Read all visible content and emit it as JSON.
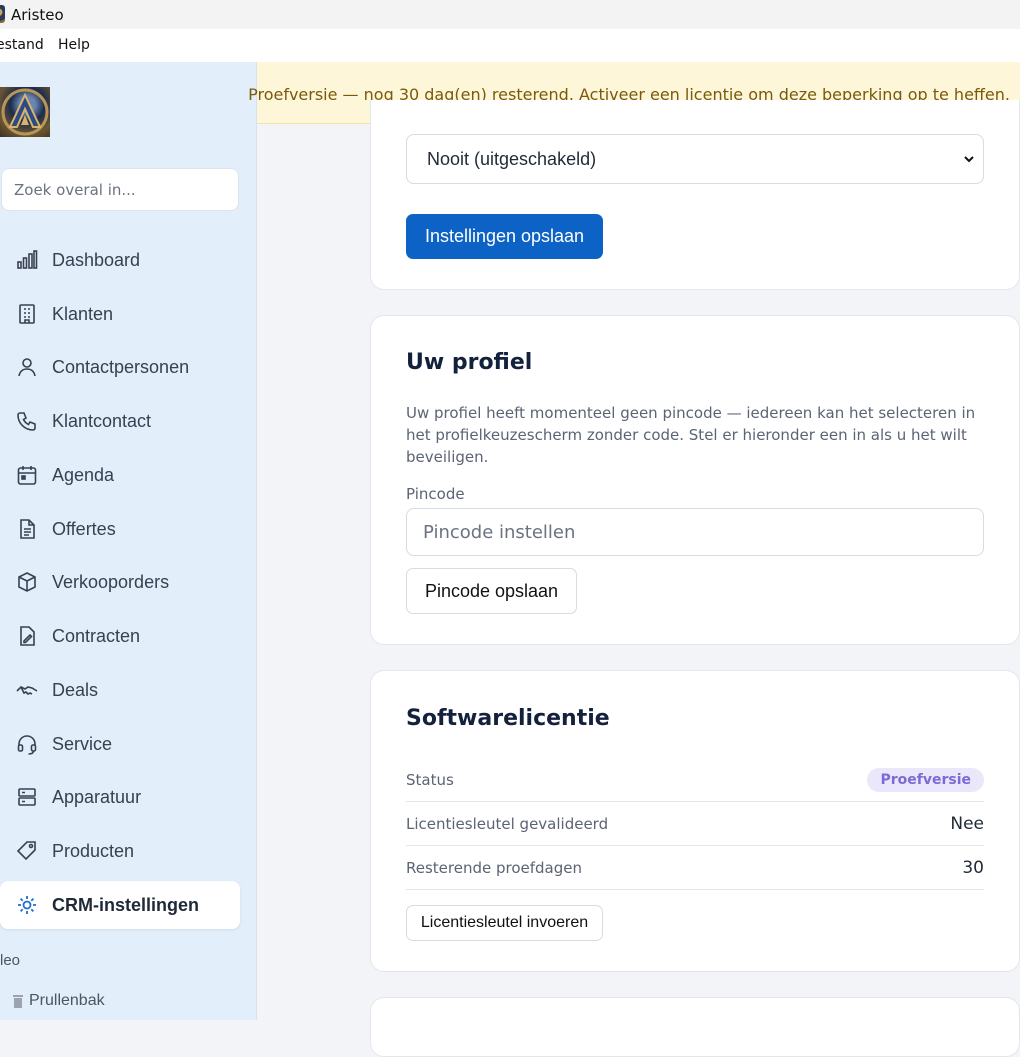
{
  "window": {
    "title": "Aristeo"
  },
  "menubar": {
    "items": [
      "estand",
      "Help"
    ]
  },
  "sidebar": {
    "search_placeholder": "Zoek overal in...",
    "items": [
      {
        "label": "Dashboard",
        "icon": "bar-chart-icon"
      },
      {
        "label": "Klanten",
        "icon": "building-icon"
      },
      {
        "label": "Contactpersonen",
        "icon": "person-icon"
      },
      {
        "label": "Klantcontact",
        "icon": "phone-icon"
      },
      {
        "label": "Agenda",
        "icon": "calendar-icon"
      },
      {
        "label": "Offertes",
        "icon": "document-icon"
      },
      {
        "label": "Verkooporders",
        "icon": "box-icon"
      },
      {
        "label": "Contracten",
        "icon": "contract-icon"
      },
      {
        "label": "Deals",
        "icon": "handshake-icon"
      },
      {
        "label": "Service",
        "icon": "headset-icon"
      },
      {
        "label": "Apparatuur",
        "icon": "server-icon"
      },
      {
        "label": "Producten",
        "icon": "tag-icon"
      },
      {
        "label": "CRM-instellingen",
        "icon": "gear-icon",
        "active": true
      }
    ],
    "footer_text": "leo",
    "trash_label": "Prullenbak"
  },
  "banner": {
    "text": "Proefversie — nog 30 dag(en) resterend. Activeer een licentie om deze beperking op te heffen."
  },
  "settings_card": {
    "select_value": "Nooit (uitgeschakeld)",
    "save_label": "Instellingen opslaan"
  },
  "profile_card": {
    "title": "Uw profiel",
    "description": "Uw profiel heeft momenteel geen pincode — iedereen kan het selecteren in het profielkeuzescherm zonder code. Stel er hieronder een in als u het wilt beveiligen.",
    "pin_label": "Pincode",
    "pin_placeholder": "Pincode instellen",
    "pin_save_label": "Pincode opslaan"
  },
  "license_card": {
    "title": "Softwarelicentie",
    "rows": [
      {
        "key": "Status",
        "value": "Proefversie"
      },
      {
        "key": "Licentiesleutel gevalideerd",
        "value": "Nee"
      },
      {
        "key": "Resterende proefdagen",
        "value": "30"
      }
    ],
    "enter_key_label": "Licentiesleutel invoeren"
  },
  "colors": {
    "accent": "#0d63c5",
    "sidebar_bg": "#e3eefb",
    "banner_bg": "#fdf6d8",
    "badge_bg": "#ebe7fb"
  }
}
